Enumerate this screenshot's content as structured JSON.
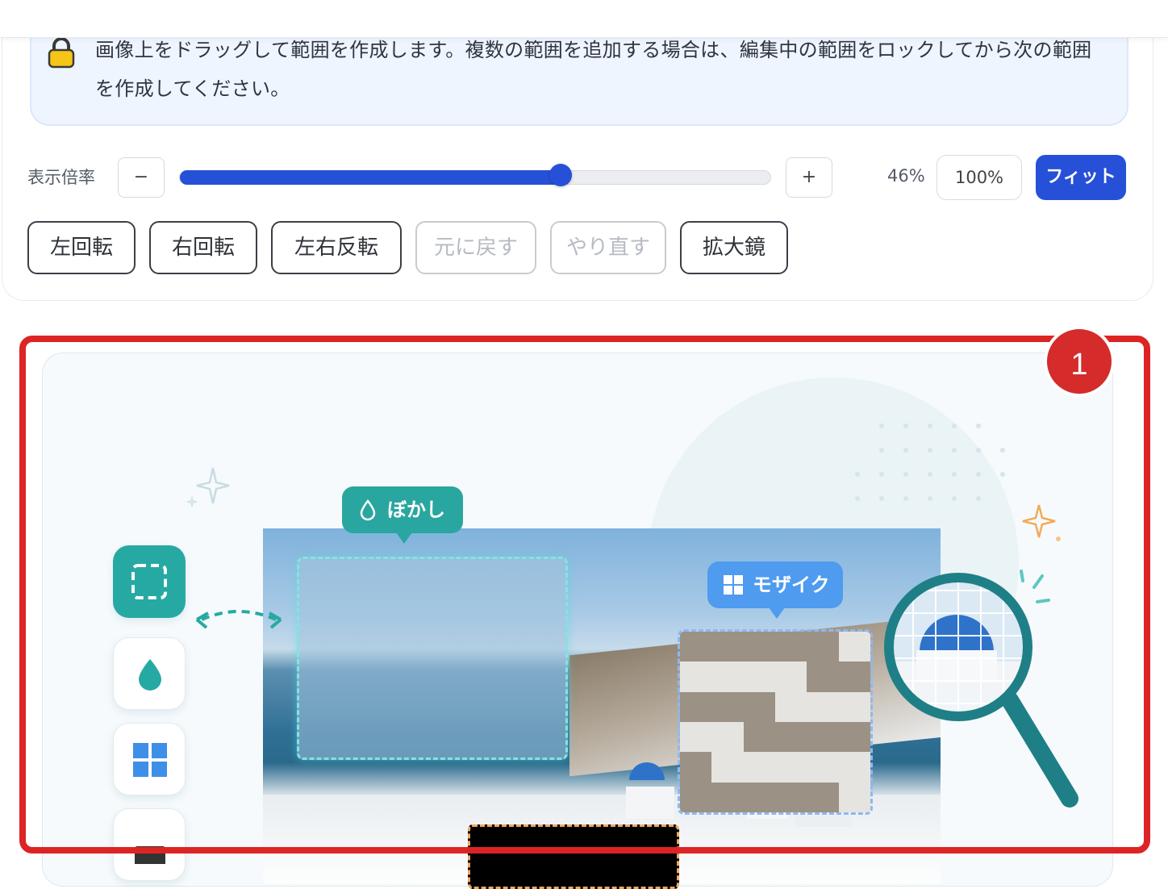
{
  "info": {
    "text": "画像上をドラッグして範囲を作成します。複数の範囲を追加する場合は、編集中の範囲をロックしてから次の範囲を作成してください。"
  },
  "zoom": {
    "label": "表示倍率",
    "minus": "−",
    "plus": "+",
    "value_text": "46%",
    "level_percent": 46,
    "btn_100": "100%",
    "btn_fit": "フィット"
  },
  "tools": [
    {
      "label": "左回転",
      "enabled": true
    },
    {
      "label": "右回転",
      "enabled": true
    },
    {
      "label": "左右反転",
      "enabled": true
    },
    {
      "label": "元に戻す",
      "enabled": false
    },
    {
      "label": "やり直す",
      "enabled": false
    },
    {
      "label": "拡大鏡",
      "enabled": true
    }
  ],
  "illustration": {
    "blur_label": "ぼかし",
    "mosaic_label": "モザイク",
    "side_icons": [
      "selection-icon",
      "droplet-icon",
      "grid-icon",
      "black-square-icon"
    ]
  },
  "annotation": {
    "badge_number": "1",
    "outline_color": "#dd2424"
  },
  "colors": {
    "accent_blue": "#2750d8",
    "teal": "#27a9a3",
    "mosaic_blue": "#4e9bf0",
    "info_bg": "#eef5ff"
  }
}
